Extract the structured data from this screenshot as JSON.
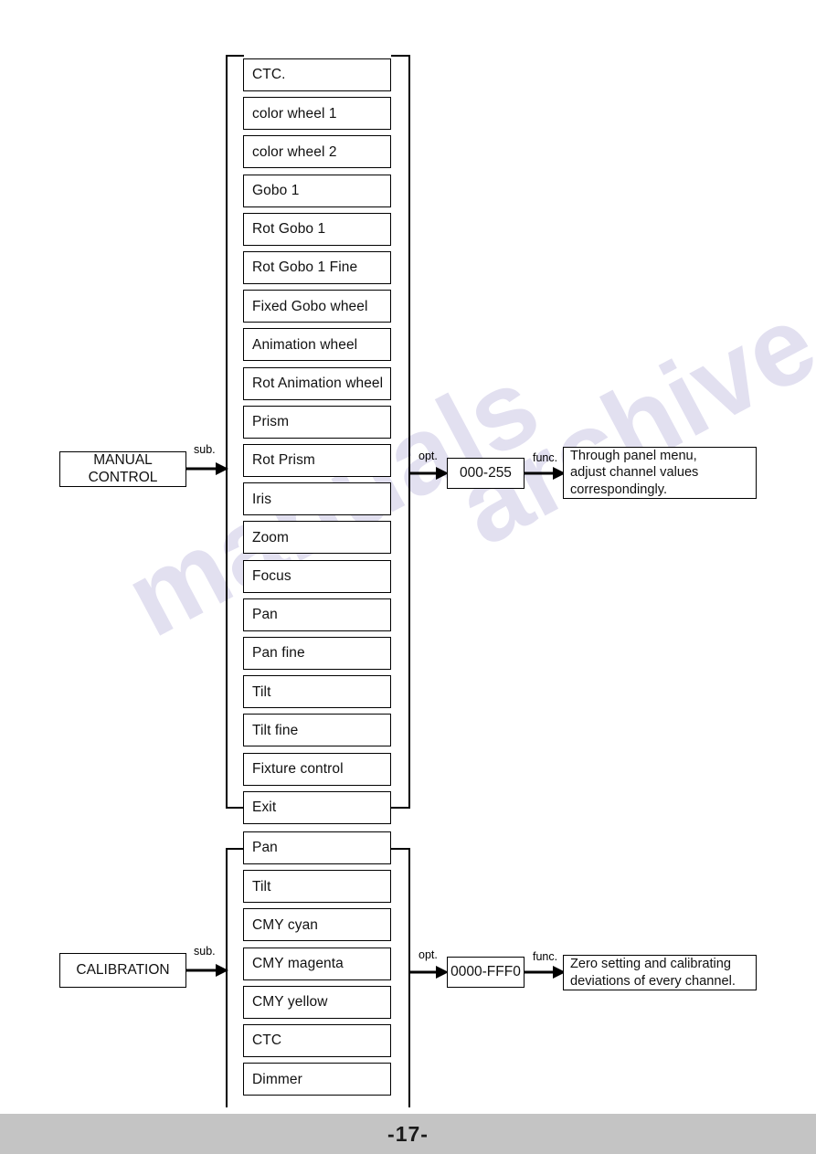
{
  "page": {
    "number_label": "-17-",
    "watermark": [
      "manuals",
      "archive.com"
    ]
  },
  "groups": [
    {
      "id": "manual-control",
      "root_label": "MANUAL\nCONTROL",
      "root_line1": "MANUAL",
      "root_line2": "CONTROL",
      "sub_label": "sub.",
      "opt_label": "opt.",
      "func_label": "func.",
      "option_value": "000-255",
      "description": "Through panel menu,\nadjust channel values\ncorrespondingly.",
      "description_lines": [
        "Through panel menu,",
        "adjust channel values",
        "correspondingly."
      ],
      "items": [
        "CTC.",
        "color wheel 1",
        "color wheel 2",
        "Gobo 1",
        "Rot Gobo 1",
        "Rot Gobo 1 Fine",
        "Fixed Gobo wheel",
        "Animation wheel",
        "Rot Animation wheel",
        "Prism",
        "Rot Prism",
        "Iris",
        "Zoom",
        "Focus",
        "Pan",
        "Pan fine",
        "Tilt",
        "Tilt fine",
        "Fixture control",
        "Exit"
      ]
    },
    {
      "id": "calibration",
      "root_label": "CALIBRATION",
      "root_line1": "CALIBRATION",
      "root_line2": "",
      "sub_label": "sub.",
      "opt_label": "opt.",
      "func_label": "func.",
      "option_value": "0000-FFF0",
      "description": "Zero setting and calibrating\ndeviations of every channel.",
      "description_lines": [
        "Zero setting and calibrating",
        "deviations of every channel."
      ],
      "items": [
        "Pan",
        "Tilt",
        "CMY cyan",
        "CMY magenta",
        "CMY yellow",
        "CTC",
        "Dimmer"
      ]
    }
  ],
  "colors": {
    "footer_bg": "#c4c4c4",
    "line": "#000000",
    "watermark": "#d9d6ec"
  }
}
